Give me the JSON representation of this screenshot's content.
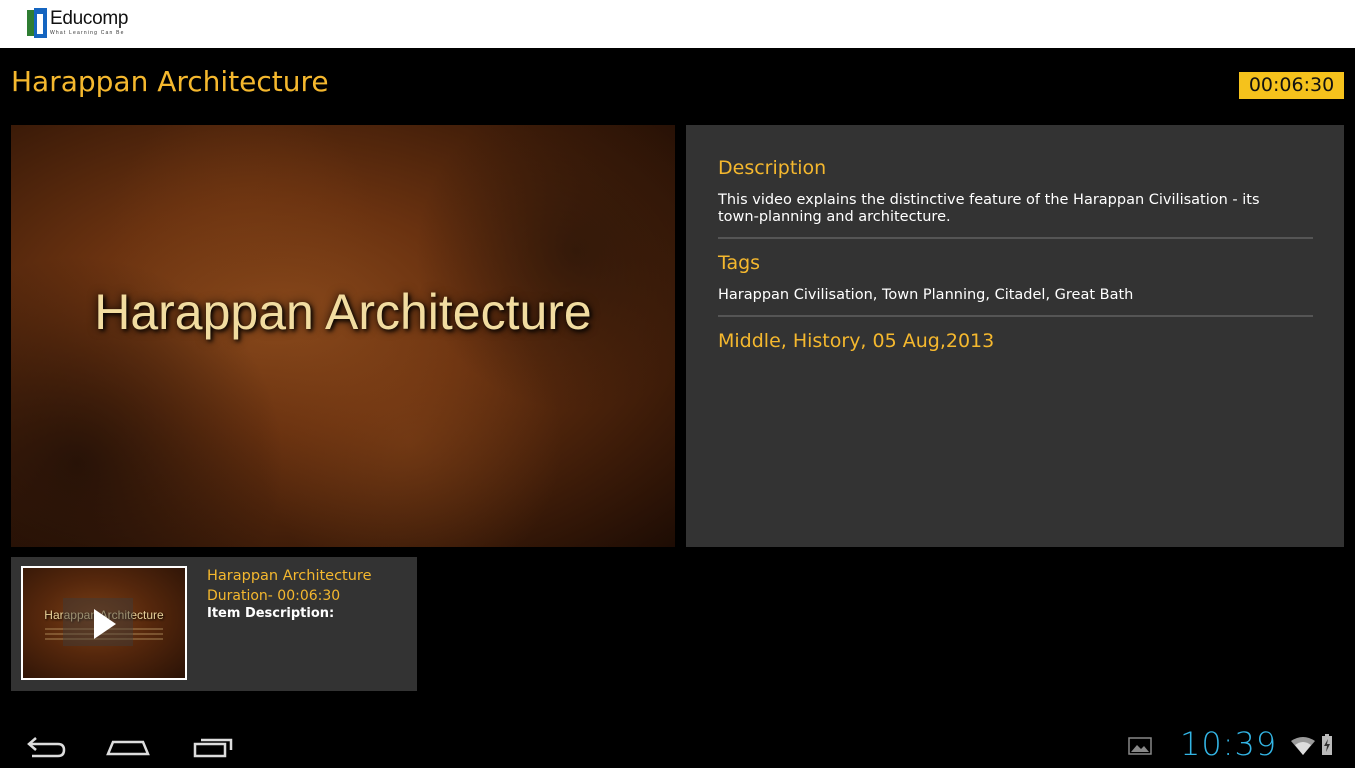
{
  "header": {
    "brand": "Educomp",
    "tagline": "What Learning Can Be"
  },
  "page": {
    "title": "Harappan Architecture",
    "duration": "00:06:30"
  },
  "video": {
    "overlay_title": "Harappan Architecture"
  },
  "details": {
    "description_heading": "Description",
    "description_text": "This video  explains the  distinctive feature of the Harappan Civilisation - its town-planning and architecture.",
    "tags_heading": "Tags",
    "tags_text": "Harappan Civilisation, Town Planning, Citadel, Great Bath",
    "meta": "Middle, History, 05 Aug,2013"
  },
  "playlist": {
    "items": [
      {
        "thumb_title": "Harappan Architecture",
        "title": "Harappan Architecture",
        "duration": "Duration-   00:06:30",
        "description": "Item Description:"
      }
    ]
  },
  "status_bar": {
    "time": "10:39",
    "accent": "#33b5e5"
  },
  "colors": {
    "accent": "#f5b82e",
    "timer_bg": "#f5c21c",
    "panel": "#333333"
  }
}
